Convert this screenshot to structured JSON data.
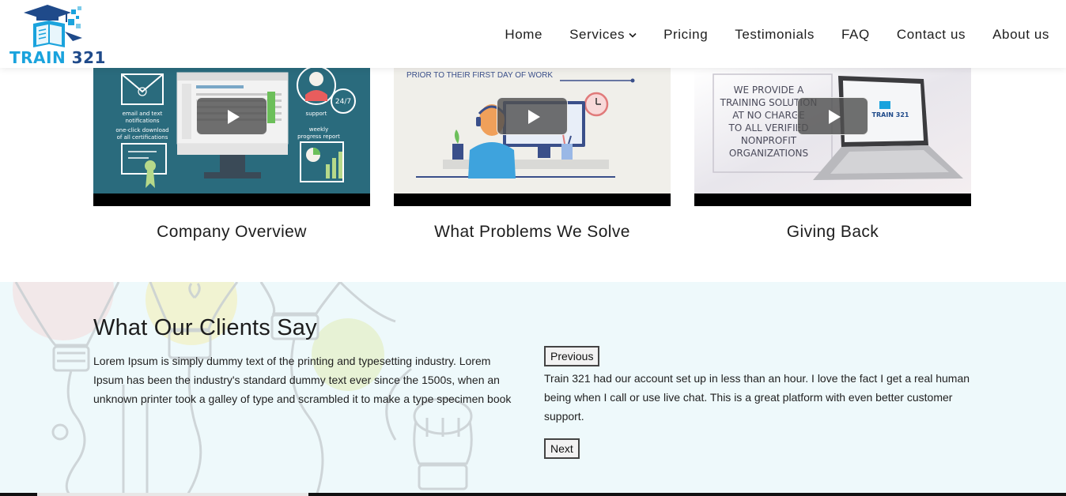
{
  "header": {
    "logo_text_a": "TRAIN",
    "logo_text_b": "321",
    "nav": [
      {
        "label": "Home"
      },
      {
        "label": "Services"
      },
      {
        "label": "Pricing"
      },
      {
        "label": "Testimonials"
      },
      {
        "label": "FAQ"
      },
      {
        "label": "Contact us"
      },
      {
        "label": "About us"
      }
    ]
  },
  "videos": [
    {
      "title": "Company Overview",
      "thumb_text": [
        "email and text",
        "notifications",
        "one-click download",
        "of all certifications",
        "support",
        "24/7",
        "weekly",
        "progress report"
      ]
    },
    {
      "title": "What Problems We Solve",
      "thumb_text": [
        "PRIOR TO THEIR FIRST DAY OF WORK"
      ]
    },
    {
      "title": "Giving Back",
      "thumb_text": [
        "WE PROVIDE A",
        "TRAINING SOLUTION",
        "AT NO CHARGE",
        "TO ALL VERIFIED",
        "NONPROFIT",
        "ORGANIZATIONS",
        "TRAIN 321"
      ]
    }
  ],
  "testimonials": {
    "title": "What Our Clients Say",
    "description": "Lorem Ipsum is simply dummy text of the printing and typesetting industry. Lorem Ipsum has been the industry's standard dummy text ever since the 1500s, when an unknown printer took a galley of type and scrambled it to make a type specimen book",
    "previous_label": "Previous",
    "next_label": "Next",
    "quote": "Train 321 had our account set up in less than an hour. I love the fact I get a real human being when I call or use live chat. This is a great platform with even better customer support."
  },
  "colors": {
    "brand_blue": "#1aa3dd",
    "brand_navy": "#1f4a8a",
    "section_bg": "#eef9fb",
    "thumb1_bg": "#2a6b7d",
    "thumb2_bg": "#f0efea"
  }
}
